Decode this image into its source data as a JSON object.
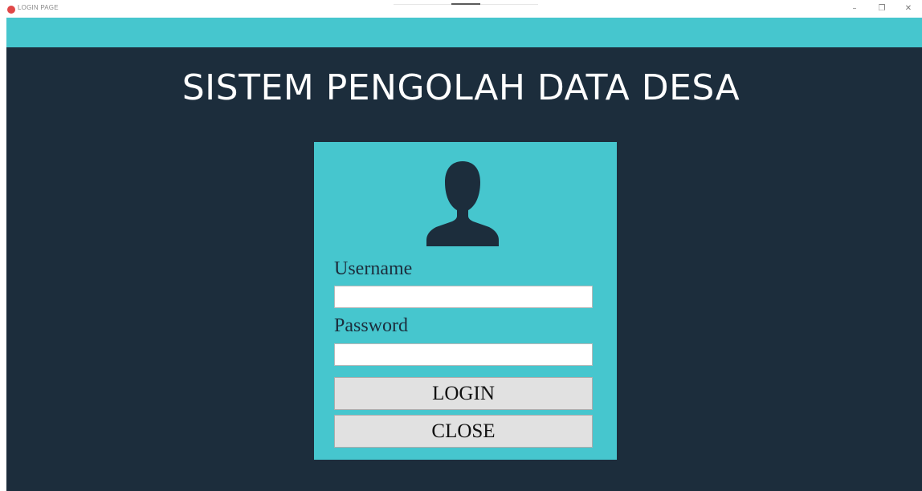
{
  "window": {
    "title": "LOGIN PAGE",
    "controls": {
      "minimize": "–",
      "maximize": "❐",
      "close": "✕"
    }
  },
  "header": {
    "title": "SISTEM PENGOLAH DATA DESA"
  },
  "login": {
    "avatar_icon": "user-silhouette-icon",
    "username_label": "Username",
    "username_value": "",
    "password_label": "Password",
    "password_value": "",
    "login_button": "LOGIN",
    "close_button": "CLOSE"
  },
  "colors": {
    "accent_teal": "#46c6ce",
    "background_dark": "#1c2d3c",
    "button_gray": "#e1e1e1"
  }
}
